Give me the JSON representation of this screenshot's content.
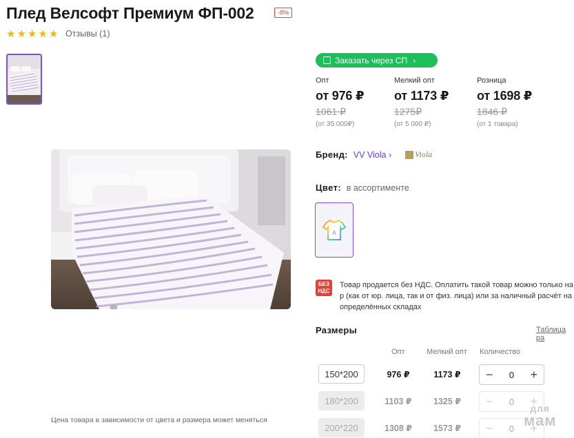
{
  "product": {
    "title": "Плед Велсофт Премиум ФП-002",
    "discount_badge": "-8%",
    "stars": 5,
    "reviews_label": "Отзывы (1)",
    "price_note": "Цена товара в зависимости от цвета и размера может меняться"
  },
  "order_button": {
    "label": "Заказать через СП",
    "color": "#1dbf5a"
  },
  "prices": [
    {
      "label": "Опт",
      "value": "от 976 ₽",
      "old": "1061 ₽",
      "min": "(от 35 000₽)"
    },
    {
      "label": "Мелкий опт",
      "value": "от 1173 ₽",
      "old": "1275₽",
      "min": "(от 5 000 ₽)"
    },
    {
      "label": "Розница",
      "value": "от 1698 ₽",
      "old": "1846 ₽",
      "min": "(от 1 товара)"
    }
  ],
  "brand": {
    "label": "Бренд:",
    "value": "VV Viola",
    "logo_text": "Viola"
  },
  "color": {
    "label": "Цвет:",
    "value": "в ассортименте"
  },
  "vat": {
    "badge_line1": "БЕЗ",
    "badge_line2": "НДС",
    "text": "Товар продается без НДС. Оплатить такой товар можно только на р (как от юр. лица, так и от физ. лица) или за наличный расчёт на определённых складах"
  },
  "sizes": {
    "title": "Размеры",
    "table_link": "Таблица ра",
    "headers": {
      "opt": "Опт",
      "small_opt": "Мелкий опт",
      "qty": "Количество"
    },
    "rows": [
      {
        "size": "150*200",
        "opt": "976 ₽",
        "small_opt": "1173 ₽",
        "qty": "0",
        "available": true
      },
      {
        "size": "180*200",
        "opt": "1103 ₽",
        "small_opt": "1325 ₽",
        "qty": "0",
        "available": false
      },
      {
        "size": "200*220",
        "opt": "1308 ₽",
        "small_opt": "1573 ₽",
        "qty": "0",
        "available": false
      }
    ]
  },
  "watermark": {
    "line1": "для",
    "line2": "мам"
  },
  "colors": {
    "accent": "#7b52d6",
    "green": "#1dbf5a",
    "red": "#e0433a",
    "star": "#f2b705"
  }
}
